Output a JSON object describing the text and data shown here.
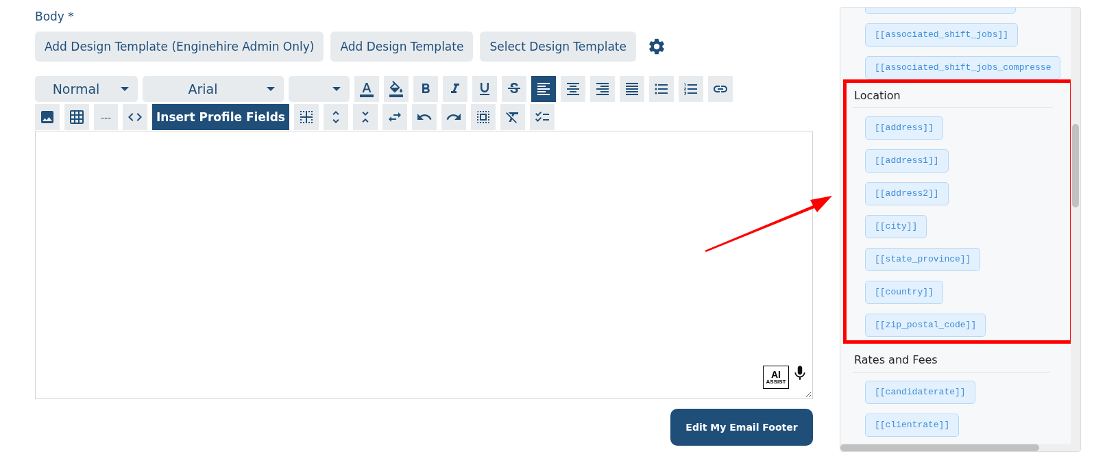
{
  "body_label": "Body *",
  "template_buttons": [
    "Add Design Template (Enginehire Admin Only)",
    "Add Design Template",
    "Select Design Template"
  ],
  "toolbar_rows": [
    [
      {
        "kind": "select",
        "value": "Normal"
      },
      {
        "kind": "select",
        "value": "Arial"
      },
      {
        "kind": "select"
      },
      {
        "kind": "icon",
        "selected": false
      },
      {
        "kind": "icon",
        "selected": false
      },
      {
        "kind": "icon",
        "selected": false
      },
      {
        "kind": "icon",
        "selected": false
      },
      {
        "kind": "icon",
        "selected": false
      },
      {
        "kind": "icon",
        "selected": false
      },
      {
        "kind": "icon",
        "selected": true
      },
      {
        "kind": "icon",
        "selected": false
      },
      {
        "kind": "icon",
        "selected": false
      },
      {
        "kind": "icon",
        "selected": false
      },
      {
        "kind": "icon",
        "selected": false
      },
      {
        "kind": "icon",
        "selected": false
      },
      {
        "kind": "icon",
        "selected": false
      }
    ],
    [
      {
        "kind": "action"
      },
      {
        "kind": "action"
      },
      {
        "kind": "text",
        "label": "---"
      },
      {
        "kind": "action"
      },
      {
        "kind": "primary",
        "label": "Insert Profile Fields"
      },
      {
        "kind": "action"
      },
      {
        "kind": "action"
      },
      {
        "kind": "action"
      },
      {
        "kind": "action"
      },
      {
        "kind": "action"
      },
      {
        "kind": "action"
      },
      {
        "kind": "action"
      },
      {
        "kind": "action"
      },
      {
        "kind": "action"
      }
    ]
  ],
  "editor": {
    "ai_badge": {
      "title": "AI",
      "subtitle": "ASSIST"
    }
  },
  "footer_button": "Edit My Email Footer",
  "fields_panel": {
    "sections": [
      {
        "chips": [
          {
            "kind": "cut"
          },
          {
            "kind": "chip",
            "label": "[[associated_shift_jobs]]"
          },
          {
            "kind": "chip",
            "label": "[[associated_shift_jobs_compresse"
          }
        ]
      },
      {
        "title": "Location",
        "highlighted": true,
        "chips": [
          {
            "kind": "chip",
            "label": "[[address]]"
          },
          {
            "kind": "chip",
            "label": "[[address1]]"
          },
          {
            "kind": "chip",
            "label": "[[address2]]"
          },
          {
            "kind": "chip",
            "label": "[[city]]"
          },
          {
            "kind": "chip",
            "label": "[[state_province]]"
          },
          {
            "kind": "chip",
            "label": "[[country]]"
          },
          {
            "kind": "chip",
            "label": "[[zip_postal_code]]"
          }
        ]
      },
      {
        "title": "Rates and Fees",
        "chips": [
          {
            "kind": "chip",
            "label": "[[candidaterate]]"
          },
          {
            "kind": "chip",
            "label": "[[clientrate]]"
          }
        ]
      }
    ]
  },
  "annotation": {
    "arrow": true,
    "color": "#ff0000"
  }
}
